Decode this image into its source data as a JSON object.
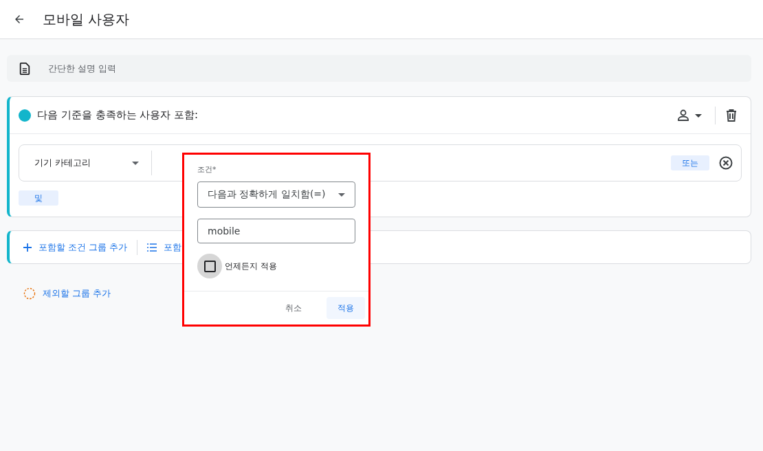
{
  "header": {
    "title": "모바일 사용자"
  },
  "description": {
    "placeholder": "간단한 설명 입력"
  },
  "include_group": {
    "title": "다음 기준을 충족하는 사용자 포함:",
    "color": "#12b5cb",
    "condition": {
      "dimension": "기기 카테고리",
      "or_label": "또는"
    },
    "and_label": "및"
  },
  "group_actions": [
    {
      "kind": "add",
      "label": "포함할 조건 그룹 추가"
    },
    {
      "kind": "list",
      "label": "포함"
    }
  ],
  "exclude_action": {
    "label": "제외할 그룹 추가"
  },
  "popup": {
    "label": "조건*",
    "operator": "다음과 정확하게 일치함(=)",
    "value": "mobile",
    "always_apply": {
      "label": "언제든지 적용",
      "checked": false
    },
    "buttons": [
      {
        "kind": "text",
        "label": "취소"
      },
      {
        "kind": "primary",
        "label": "적용"
      }
    ]
  }
}
